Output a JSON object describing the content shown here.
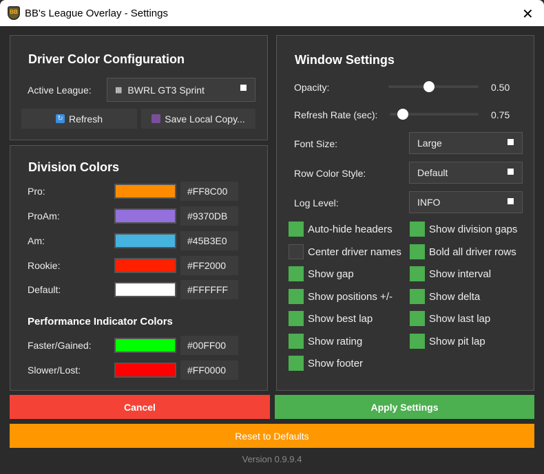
{
  "window": {
    "title": "BB's League Overlay - Settings",
    "logo_text": "BB"
  },
  "driver_config": {
    "title": "Driver Color Configuration",
    "active_league_label": "Active League:",
    "active_league_value": "BWRL GT3 Sprint",
    "refresh_label": "Refresh",
    "save_label": "Save Local Copy..."
  },
  "division_colors": {
    "title": "Division Colors",
    "rows": [
      {
        "label": "Pro:",
        "hex": "#FF8C00"
      },
      {
        "label": "ProAm:",
        "hex": "#9370DB"
      },
      {
        "label": "Am:",
        "hex": "#45B3E0"
      },
      {
        "label": "Rookie:",
        "hex": "#FF2000"
      },
      {
        "label": "Default:",
        "hex": "#FFFFFF"
      }
    ],
    "perf_title": "Performance Indicator Colors",
    "perf_rows": [
      {
        "label": "Faster/Gained:",
        "hex": "#00FF00"
      },
      {
        "label": "Slower/Lost:",
        "hex": "#FF0000"
      }
    ]
  },
  "window_settings": {
    "title": "Window Settings",
    "opacity": {
      "label": "Opacity:",
      "value": "0.50",
      "fraction": 0.45
    },
    "refresh_rate": {
      "label": "Refresh Rate (sec):",
      "value": "0.75",
      "fraction": 0.15
    },
    "font_size": {
      "label": "Font Size:",
      "value": "Large"
    },
    "row_color_style": {
      "label": "Row Color Style:",
      "value": "Default"
    },
    "log_level": {
      "label": "Log Level:",
      "value": "INFO"
    },
    "checkboxes_left": [
      {
        "label": "Auto-hide headers",
        "checked": true
      },
      {
        "label": "Center driver names",
        "checked": false
      },
      {
        "label": "Show gap",
        "checked": true
      },
      {
        "label": "Show positions +/-",
        "checked": true
      },
      {
        "label": "Show best lap",
        "checked": true
      },
      {
        "label": "Show rating",
        "checked": true
      },
      {
        "label": "Show footer",
        "checked": true
      }
    ],
    "checkboxes_right": [
      {
        "label": "Show division gaps",
        "checked": true
      },
      {
        "label": "Bold all driver rows",
        "checked": true
      },
      {
        "label": "Show interval",
        "checked": true
      },
      {
        "label": "Show delta",
        "checked": true
      },
      {
        "label": "Show last lap",
        "checked": true
      },
      {
        "label": "Show pit lap",
        "checked": true
      }
    ]
  },
  "buttons": {
    "cancel": "Cancel",
    "apply": "Apply Settings",
    "reset": "Reset to Defaults"
  },
  "colors": {
    "cancel": "#F44336",
    "apply": "#4CAF50",
    "reset": "#FF9800"
  },
  "version": "Version 0.9.9.4"
}
